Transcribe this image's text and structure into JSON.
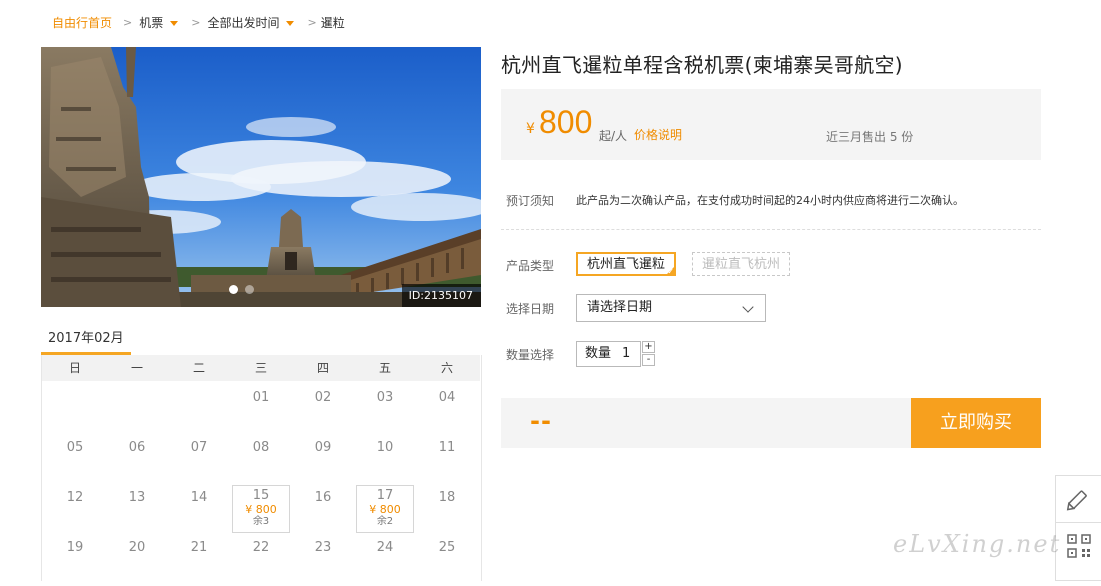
{
  "breadcrumb": {
    "home": "自由行首页",
    "item1": "机票",
    "item2": "全部出发时间",
    "item3": "暹粒"
  },
  "hero": {
    "id_label": "ID:2135107"
  },
  "calendar": {
    "month_label": "2017年02月",
    "weekdays": [
      "日",
      "一",
      "二",
      "三",
      "四",
      "五",
      "六"
    ],
    "weeks": [
      [
        "",
        "",
        "",
        "01",
        "02",
        "03",
        "04"
      ],
      [
        "05",
        "06",
        "07",
        "08",
        "09",
        "10",
        "11"
      ],
      [
        "12",
        "13",
        "14",
        "15",
        "16",
        "17",
        "18"
      ],
      [
        "19",
        "20",
        "21",
        "22",
        "23",
        "24",
        "25"
      ]
    ],
    "priced_days": {
      "d15": {
        "day": "15",
        "price": "¥ 800",
        "remain": "余3"
      },
      "d17": {
        "day": "17",
        "price": "¥ 800",
        "remain": "余2"
      }
    }
  },
  "product": {
    "title": "杭州直飞暹粒单程含税机票(柬埔寨吴哥航空)",
    "currency": "¥",
    "price": "800",
    "unit": "起/人",
    "price_note": "价格说明",
    "sold": "近三月售出 5 份",
    "notice_label": "预订须知",
    "notice_text": "此产品为二次确认产品，在支付成功时间起的24小时内供应商将进行二次确认。",
    "type_label": "产品类型",
    "type_options": [
      "杭州直飞暹粒",
      "暹粒直飞杭州"
    ],
    "date_label": "选择日期",
    "date_placeholder": "请选择日期",
    "qty_label": "数量选择",
    "qty_prefix": "数量",
    "qty_value": "1",
    "qty_plus": "+",
    "qty_minus": "-",
    "total": "--",
    "buy_label": "立即购买"
  },
  "watermark": "eLvXing.net",
  "colors": {
    "accent": "#f08c00",
    "buy_button": "#f7a01e",
    "panel_bg": "#f4f4f4"
  }
}
